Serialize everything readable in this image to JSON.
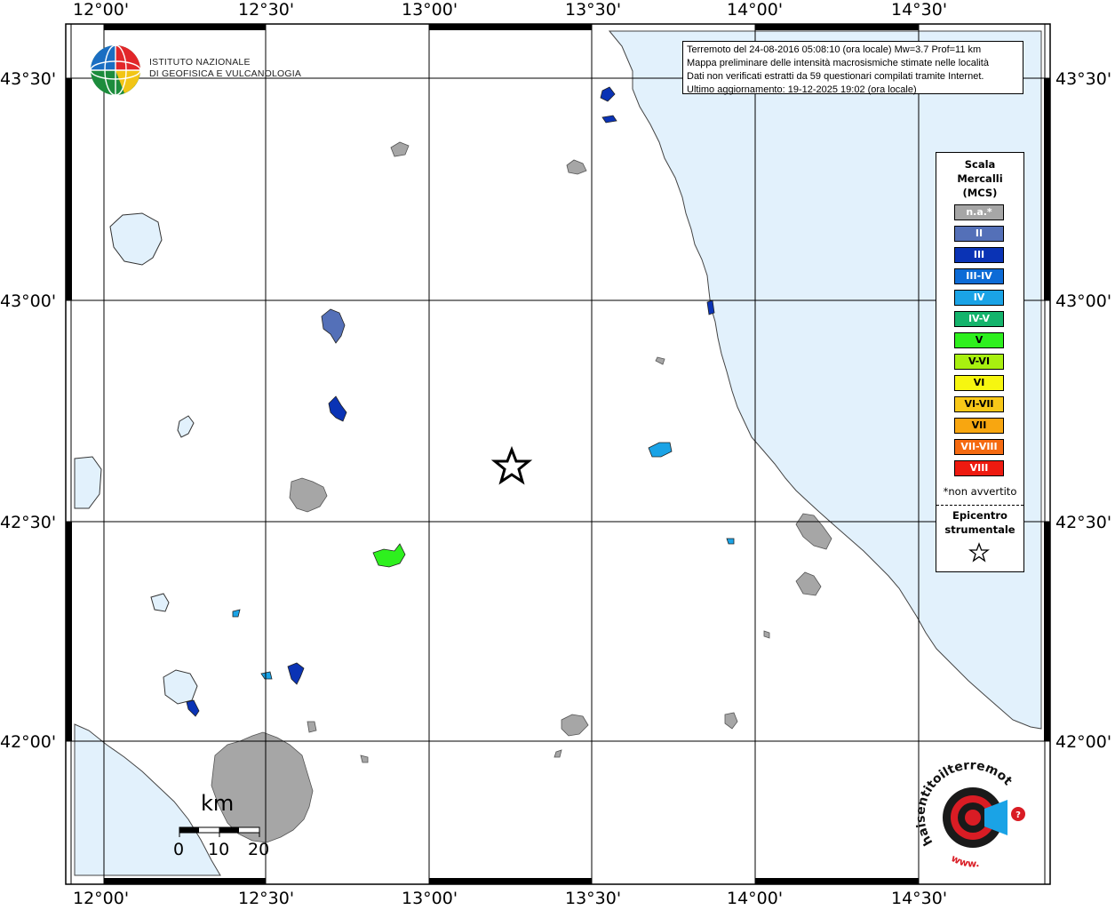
{
  "info": {
    "line1": "Terremoto del 24-08-2016 05:08:10 (ora locale) Mw=3.7 Prof=11 km",
    "line2": "Mappa preliminare delle intensità macrosismiche stimate nelle località",
    "line3": "Dati non verificati estratti da 59 questionari compilati tramite Internet.",
    "line4": "Ultimo aggiornamento: 19-12-2025 19:02 (ora locale)"
  },
  "institute": {
    "line1": "ISTITUTO NAZIONALE",
    "line2": "DI GEOFISICA E VULCANOLOGIA"
  },
  "axes": {
    "lon_labels": [
      "12°00'",
      "12°30'",
      "13°00'",
      "13°30'",
      "14°00'",
      "14°30'"
    ],
    "lat_labels": [
      "43°30'",
      "43°00'",
      "42°30'",
      "42°00'"
    ]
  },
  "legend": {
    "title1": "Scala",
    "title2": "Mercalli",
    "title3": "(MCS)",
    "na_note": "*non avvertito",
    "epicenter1": "Epicentro",
    "epicenter2": "strumentale",
    "classes": [
      {
        "label": "n.a.*",
        "color": "#a6a6a6"
      },
      {
        "label": "II",
        "color": "#5470b8"
      },
      {
        "label": "III",
        "color": "#0a33b5"
      },
      {
        "label": "III-IV",
        "color": "#0c6bd6"
      },
      {
        "label": "IV",
        "color": "#1aa3e6"
      },
      {
        "label": "IV-V",
        "color": "#14b46c"
      },
      {
        "label": "V",
        "color": "#2ef01e"
      },
      {
        "label": "V-VI",
        "color": "#a8f010"
      },
      {
        "label": "VI",
        "color": "#f6f610"
      },
      {
        "label": "VI-VII",
        "color": "#f8c818"
      },
      {
        "label": "VII",
        "color": "#f8a610"
      },
      {
        "label": "VII-VIII",
        "color": "#f56a10"
      },
      {
        "label": "VIII",
        "color": "#ee1a10"
      }
    ]
  },
  "scalebar": {
    "unit": "km",
    "ticks": [
      "0",
      "10",
      "20"
    ]
  },
  "brand": {
    "text": "haisentitoilterremoto.it",
    "url_text": "www."
  },
  "colors": {
    "sea": "#e2f1fc",
    "land": "#ffffff",
    "urban": "#a6a6a6",
    "grid": "#000000"
  }
}
